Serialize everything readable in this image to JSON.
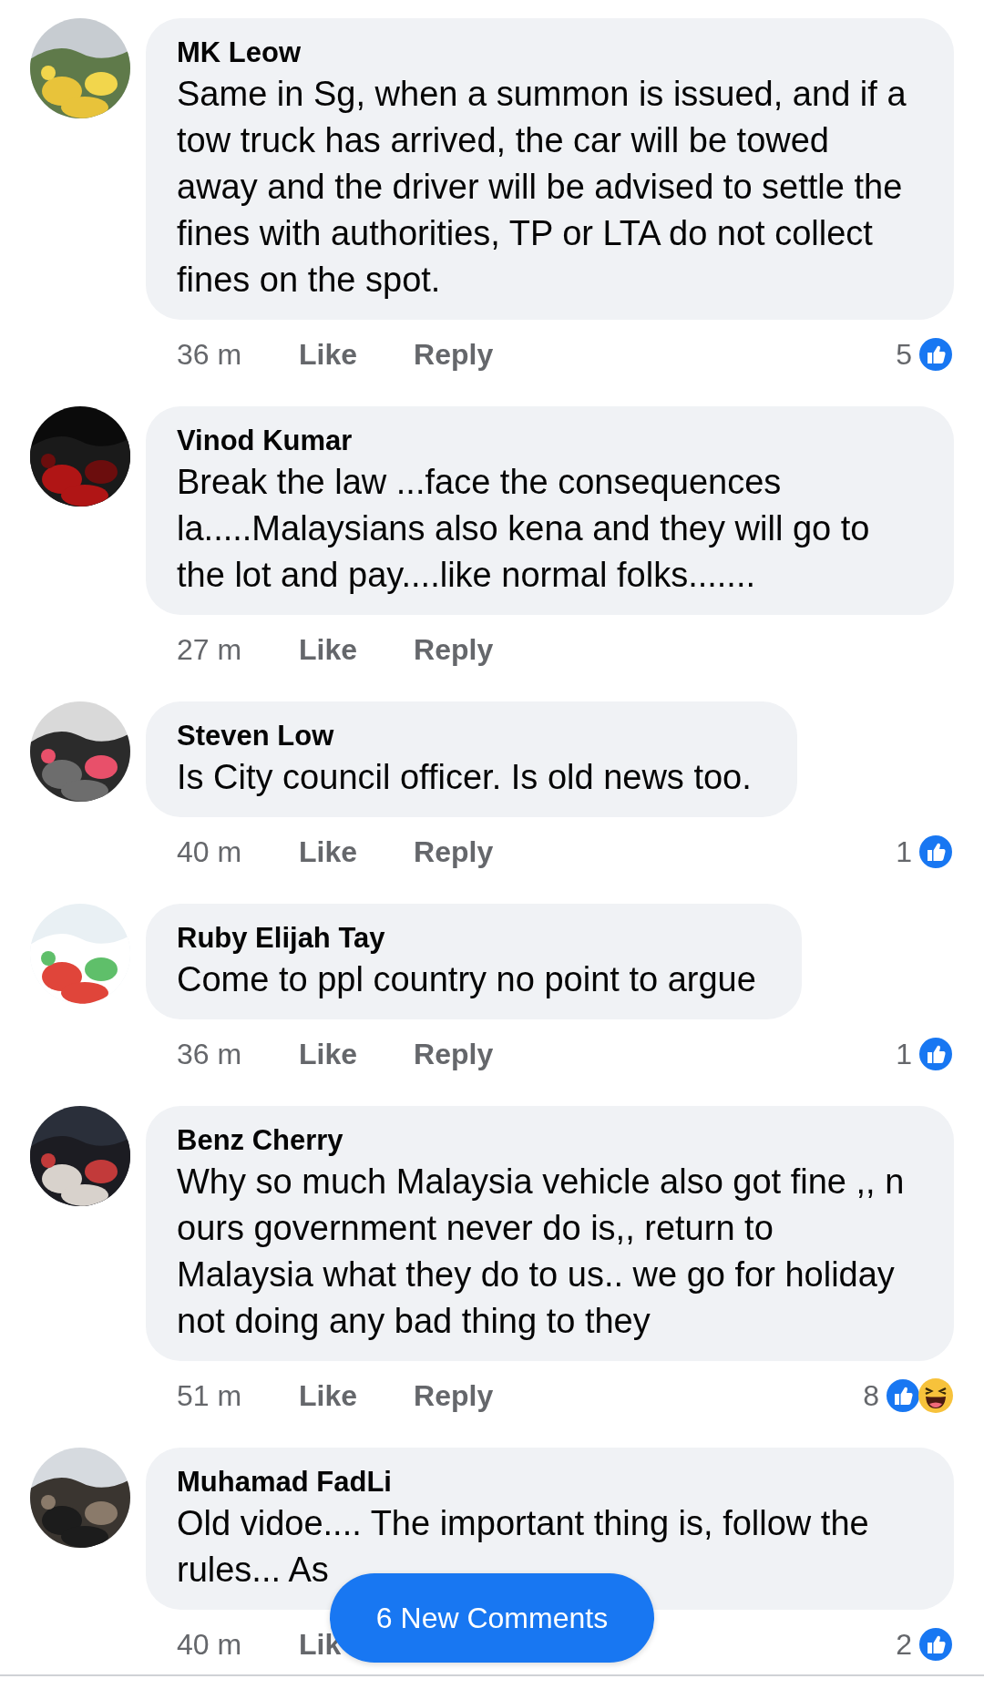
{
  "comments": [
    {
      "author": "MK Leow",
      "body": "Same in Sg, when a summon is issued, and if a tow truck has arrived, the car will be towed away and the driver will be advised to settle the fines with authorities, TP or LTA do not collect fines on the spot.",
      "avatar": {
        "kind": "picture"
      },
      "time": "36 m",
      "like": "Like",
      "reply": "Reply",
      "reaction_count": "5",
      "reactions": [
        {
          "kind": "like"
        }
      ]
    },
    {
      "author": "Vinod Kumar",
      "body": "Break the law ...face the consequences la.....Malaysians also kena and they will go to the lot and pay....like normal folks.......",
      "avatar": {
        "kind": "picture"
      },
      "time": "27 m",
      "like": "Like",
      "reply": "Reply"
    },
    {
      "author": "Steven Low",
      "body": "Is City council officer. Is old news too.",
      "avatar": {
        "kind": "picture"
      },
      "time": "40 m",
      "like": "Like",
      "reply": "Reply",
      "reaction_count": "1",
      "reactions": [
        {
          "kind": "like"
        }
      ]
    },
    {
      "author": "Ruby Elijah Tay",
      "body": "Come to ppl country no point to argue",
      "avatar": {
        "kind": "picture"
      },
      "time": "36 m",
      "like": "Like",
      "reply": "Reply",
      "reaction_count": "1",
      "reactions": [
        {
          "kind": "like"
        }
      ]
    },
    {
      "author": "Benz Cherry",
      "body": "Why so much Malaysia vehicle also got fine ,, n ours government never do is,, return to Malaysia what they do to us.. we go for holiday not doing any bad thing to they",
      "avatar": {
        "kind": "picture"
      },
      "time": "51 m",
      "like": "Like",
      "reply": "Reply",
      "reaction_count": "8",
      "reactions": [
        {
          "kind": "like"
        },
        {
          "kind": "haha"
        }
      ]
    },
    {
      "author": "Muhamad FadLi",
      "body": "Old vidoe.... The important thing is, follow the rules... As",
      "avatar": {
        "kind": "picture"
      },
      "time": "40 m",
      "like": "Lik",
      "reaction_count": "2",
      "reactions": [
        {
          "kind": "like"
        }
      ]
    }
  ],
  "new_comments_button": "6 New Comments"
}
